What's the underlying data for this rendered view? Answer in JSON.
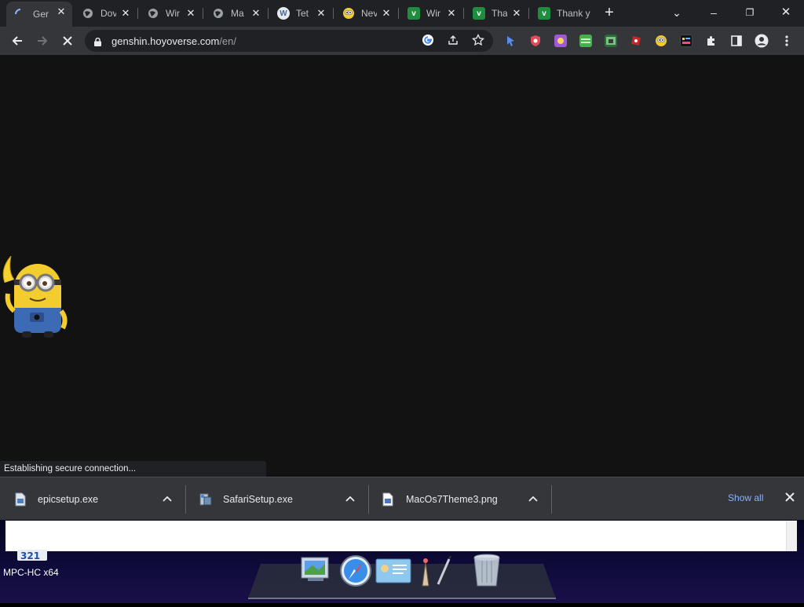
{
  "tabs": [
    {
      "title": "Ger",
      "favicon": "loading-spinner-icon",
      "active": true
    },
    {
      "title": "Dov",
      "favicon": "globe-icon"
    },
    {
      "title": "Wir",
      "favicon": "globe-icon"
    },
    {
      "title": "Ma",
      "favicon": "globe-icon"
    },
    {
      "title": "Tet",
      "favicon": "wordpress-icon"
    },
    {
      "title": "Nev",
      "favicon": "minion-icon"
    },
    {
      "title": "Wir",
      "favicon": "green-v-icon"
    },
    {
      "title": "Tha",
      "favicon": "green-v-icon"
    },
    {
      "title": "Thank y",
      "favicon": "green-v-icon"
    }
  ],
  "new_tab_label": "+",
  "window_controls": {
    "tab_search": "⌄",
    "minimize": "–",
    "restore": "❐",
    "close": "✕"
  },
  "omnibox": {
    "host": "genshin.hoyoverse.com",
    "path": "/en/"
  },
  "status_text": "Establishing secure connection...",
  "downloads": [
    {
      "name": "epicsetup.exe",
      "icon": "exe-file-icon"
    },
    {
      "name": "SafariSetup.exe",
      "icon": "installer-file-icon"
    },
    {
      "name": "MacOs7Theme3.png",
      "icon": "image-file-icon"
    }
  ],
  "show_all_label": "Show all",
  "desktop": {
    "mpc_label": "MPC-HC x64"
  },
  "colors": {
    "tabstrip": "#202124",
    "toolbar": "#35363a",
    "page_bg": "#121212",
    "link": "#8ab4f8"
  }
}
